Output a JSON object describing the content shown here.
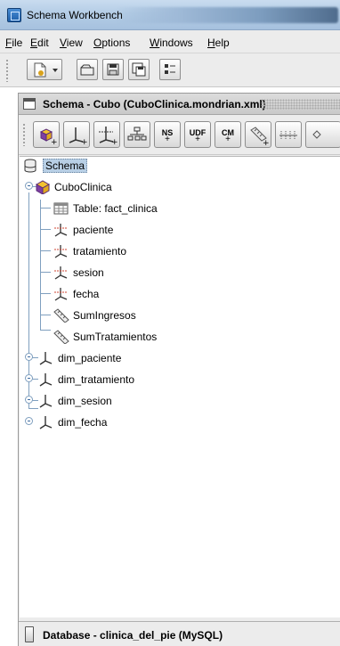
{
  "window": {
    "title": "Schema Workbench"
  },
  "menu": [
    {
      "mnemonic": "F",
      "rest": "ile"
    },
    {
      "mnemonic": "E",
      "rest": "dit"
    },
    {
      "mnemonic": "V",
      "rest": "iew"
    },
    {
      "mnemonic": "O",
      "rest": "ptions"
    },
    {
      "mnemonic": "W",
      "rest": "indows"
    },
    {
      "mnemonic": "H",
      "rest": "elp"
    }
  ],
  "main_toolbar": [
    "new-schema-icon",
    "open-icon",
    "save-icon",
    "save-as-icon",
    "preferences-icon"
  ],
  "schema_frame": {
    "title": "Schema - Cubo (CuboClinica.mondrian.xml)",
    "toolbar": [
      {
        "icon": "add-cube-icon"
      },
      {
        "icon": "add-dimension-icon"
      },
      {
        "icon": "add-dimension-usage-icon"
      },
      {
        "icon": "add-hierarchy-icon"
      },
      {
        "icon": "add-named-set-icon",
        "label": "NS"
      },
      {
        "icon": "add-user-defined-function-icon",
        "label": "UDF"
      },
      {
        "icon": "add-calculated-member-icon",
        "label": "CM"
      },
      {
        "icon": "add-measure-icon"
      },
      {
        "icon": "add-level-icon"
      }
    ],
    "tree": {
      "root": "Schema",
      "cube": {
        "name": "CuboClinica",
        "table": "Table: fact_clinica",
        "dimension_usages": [
          "paciente",
          "tratamiento",
          "sesion",
          "fecha"
        ],
        "measures": [
          "SumIngresos",
          "SumTratamientos"
        ]
      },
      "dimensions": [
        "dim_paciente",
        "dim_tratamiento",
        "dim_sesion",
        "dim_fecha"
      ]
    },
    "status": "Database - clinica_del_pie (MySQL)"
  },
  "colors": {
    "selection": "#b8cfe5",
    "cube_icon_yellow": "#f2c230",
    "cube_icon_purple": "#7e3fa2",
    "tree_line": "#7f9fbf"
  }
}
